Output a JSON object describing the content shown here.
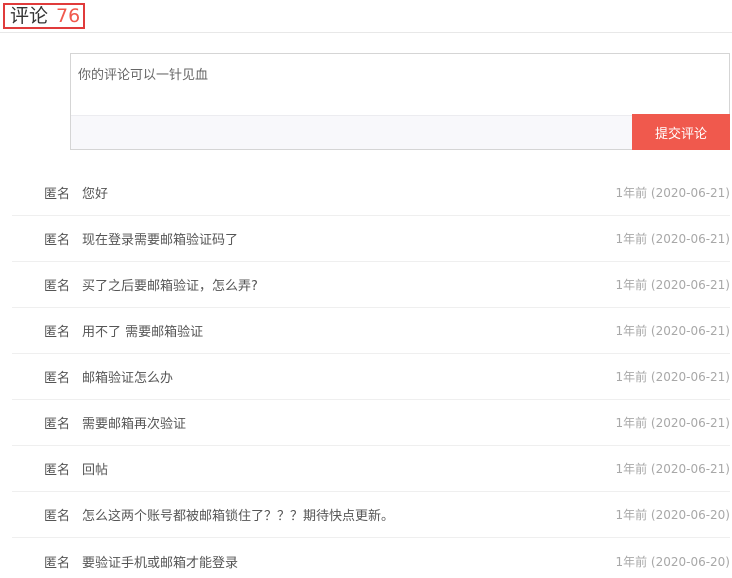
{
  "header": {
    "title": "评论",
    "count": "76"
  },
  "compose": {
    "placeholder": "你的评论可以一针见血",
    "value": "",
    "submit_label": "提交评论"
  },
  "colors": {
    "accent": "#f0594d",
    "title_border": "#e03b3b",
    "text": "#555555",
    "muted": "#a8a8a8"
  },
  "comments": [
    {
      "author": "匿名",
      "text": "您好",
      "time": "1年前 (2020-06-21)"
    },
    {
      "author": "匿名",
      "text": "现在登录需要邮箱验证码了",
      "time": "1年前 (2020-06-21)"
    },
    {
      "author": "匿名",
      "text": "买了之后要邮箱验证，怎么弄?",
      "time": "1年前 (2020-06-21)"
    },
    {
      "author": "匿名",
      "text": "用不了 需要邮箱验证",
      "time": "1年前 (2020-06-21)"
    },
    {
      "author": "匿名",
      "text": "邮箱验证怎么办",
      "time": "1年前 (2020-06-21)"
    },
    {
      "author": "匿名",
      "text": "需要邮箱再次验证",
      "time": "1年前 (2020-06-21)"
    },
    {
      "author": "匿名",
      "text": "回帖",
      "time": "1年前 (2020-06-21)"
    },
    {
      "author": "匿名",
      "text": "怎么这两个账号都被邮箱锁住了？？？期待快点更新。",
      "time": "1年前 (2020-06-20)"
    },
    {
      "author": "匿名",
      "text": "要验证手机或邮箱才能登录",
      "time": "1年前 (2020-06-20)"
    }
  ]
}
